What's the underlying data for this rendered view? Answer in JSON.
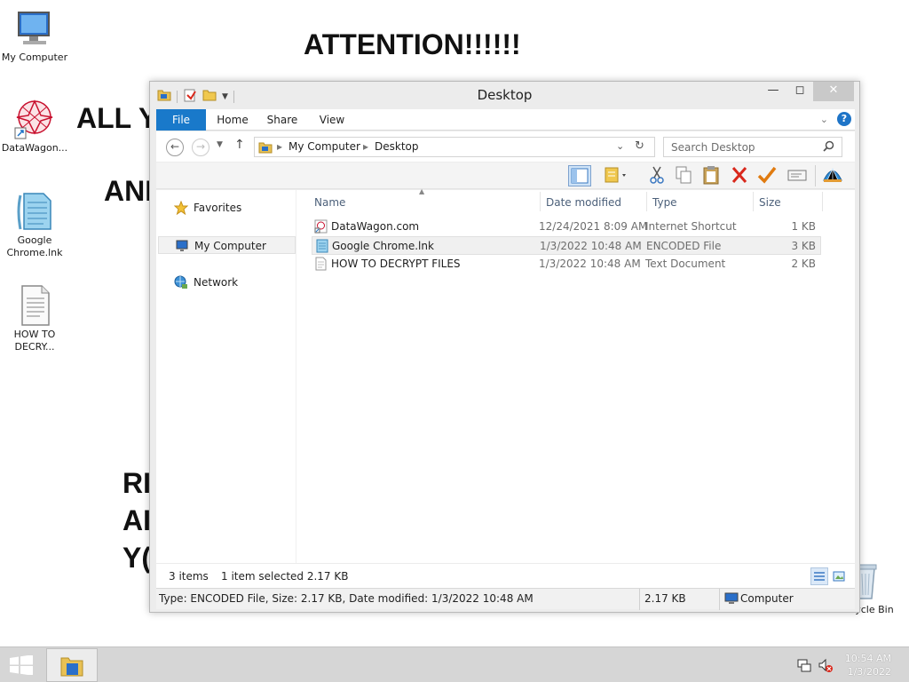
{
  "wallpaper": {
    "attention": "ATTENTION!!!!!!",
    "line1": "ALL Y",
    "line2": "ANI",
    "line3": "RI",
    "line4": "AI",
    "line5": "Y("
  },
  "desktop_icons": [
    {
      "label": "My Computer",
      "icon": "computer-icon"
    },
    {
      "label": "DataWagon...",
      "icon": "web-shortcut-icon"
    },
    {
      "label": "Google Chrome.lnk",
      "icon": "encoded-file-icon"
    },
    {
      "label": "HOW TO DECRY...",
      "icon": "text-document-icon"
    },
    {
      "label": "Recycle Bin",
      "icon": "recycle-bin-icon"
    }
  ],
  "window": {
    "title": "Desktop",
    "tabs": [
      {
        "label": "File"
      },
      {
        "label": "Home"
      },
      {
        "label": "Share"
      },
      {
        "label": "View"
      }
    ],
    "address": {
      "segment1": "My Computer",
      "segment2": "Desktop"
    },
    "search_placeholder": "Search Desktop",
    "nav_pane": [
      {
        "label": "Favorites",
        "icon": "star-icon"
      },
      {
        "label": "My Computer",
        "icon": "computer-icon"
      },
      {
        "label": "Network",
        "icon": "network-icon"
      }
    ],
    "columns": {
      "name": "Name",
      "date": "Date modified",
      "type": "Type",
      "size": "Size"
    },
    "files": [
      {
        "name": "DataWagon.com",
        "date": "12/24/2021 8:09 AM",
        "type": "Internet Shortcut",
        "size": "1 KB",
        "icon": "web-shortcut-icon",
        "selected": false
      },
      {
        "name": "Google Chrome.lnk",
        "date": "1/3/2022 10:48 AM",
        "type": "ENCODED File",
        "size": "3 KB",
        "icon": "encoded-file-icon",
        "selected": true
      },
      {
        "name": "HOW TO DECRYPT FILES",
        "date": "1/3/2022 10:48 AM",
        "type": "Text Document",
        "size": "2 KB",
        "icon": "text-document-icon",
        "selected": false
      }
    ],
    "status": {
      "items": "3 items",
      "selection": "1 item selected  2.17 KB"
    },
    "details": {
      "info": "Type: ENCODED File, Size: 2.17 KB, Date modified: 1/3/2022 10:48 AM",
      "size": "2.17 KB",
      "location": "Computer"
    }
  },
  "taskbar": {
    "time": "10:54 AM",
    "date": "1/3/2022"
  },
  "colors": {
    "file_tab": "#1979ca",
    "accent": "#1e74c7",
    "delete_red": "#d9281c",
    "check_orange": "#e07b10"
  }
}
